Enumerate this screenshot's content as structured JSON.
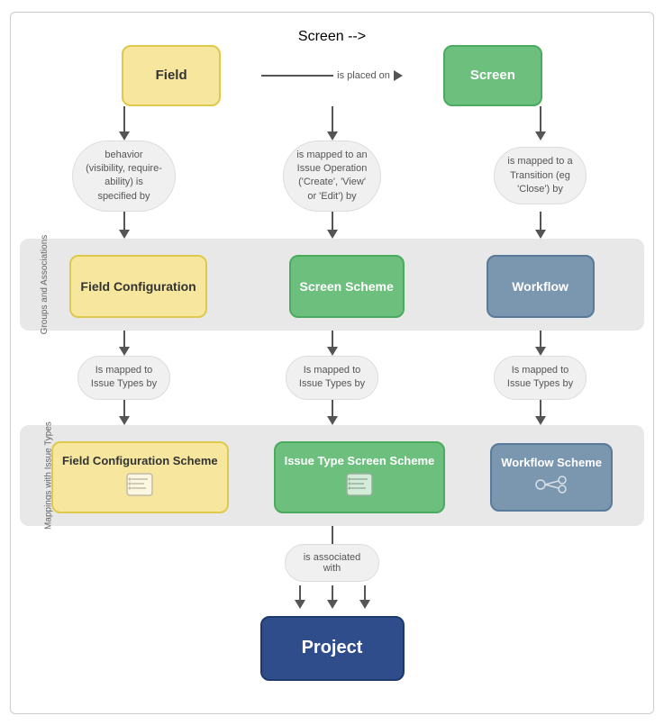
{
  "nodes": {
    "field": "Field",
    "screen": "Screen",
    "field_config": "Field Configuration",
    "screen_scheme": "Screen Scheme",
    "workflow": "Workflow",
    "field_config_scheme": "Field Configuration Scheme",
    "issue_type_screen_scheme": "Issue Type Screen Scheme",
    "workflow_scheme": "Workflow Scheme",
    "project": "Project"
  },
  "arrows": {
    "is_placed_on": "is placed on"
  },
  "labels": {
    "behavior": "behavior\n(visibility, require-\nability) is\nspecified by",
    "mapped_operation": "is mapped to an\nIssue Operation\n('Create', 'View'\nor 'Edit') by",
    "mapped_transition": "is mapped to a\nTransition (eg\n'Close') by",
    "mapped_issue_types_1": "Is mapped to\nIssue Types by",
    "mapped_issue_types_2": "Is mapped to\nIssue Types by",
    "mapped_issue_types_3": "Is mapped to\nIssue Types by",
    "associated_with": "is associated\nwith"
  },
  "band_labels": {
    "groups": "Groups and Associations",
    "mappings": "Mappings with Issue Types"
  }
}
